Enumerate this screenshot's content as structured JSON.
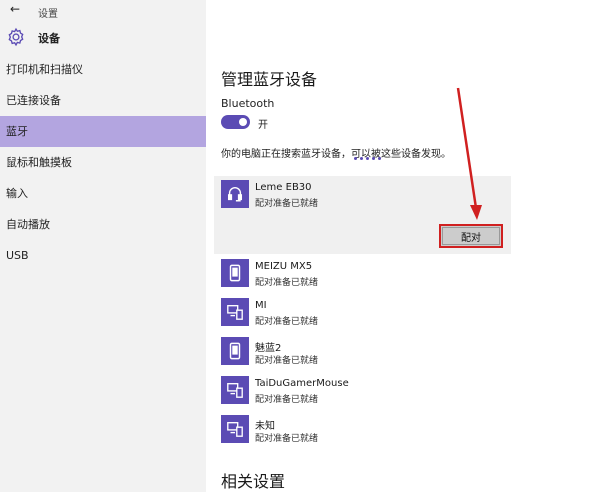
{
  "window": {
    "title": "设置",
    "back_glyph": "←"
  },
  "header": {
    "title": "设备"
  },
  "sidebar": {
    "items": [
      {
        "label": "打印机和扫描仪",
        "active": false
      },
      {
        "label": "已连接设备",
        "active": false
      },
      {
        "label": "蓝牙",
        "active": true
      },
      {
        "label": "鼠标和触摸板",
        "active": false
      },
      {
        "label": "输入",
        "active": false
      },
      {
        "label": "自动播放",
        "active": false
      },
      {
        "label": "USB",
        "active": false
      }
    ]
  },
  "main": {
    "title": "管理蓝牙设备",
    "bluetooth_label": "Bluetooth",
    "toggle_state": "开",
    "search_text": "你的电脑正在搜索蓝牙设备，可以被这些设备发现。",
    "pair_button": "配对",
    "related_title": "相关设置",
    "devices": [
      {
        "name": "Leme EB30",
        "status": "配对准备已就绪",
        "icon": "headset-icon"
      },
      {
        "name": "MEIZU MX5",
        "status": "配对准备已就绪",
        "icon": "phone-icon"
      },
      {
        "name": "MI",
        "status": "配对准备已就绪",
        "icon": "computer-devices-icon"
      },
      {
        "name": "魅蓝2",
        "status": "配对准备已就绪",
        "icon": "phone-icon"
      },
      {
        "name": "TaiDuGamerMouse",
        "status": "配对准备已就绪",
        "icon": "computer-devices-icon"
      },
      {
        "name": "未知",
        "status": "配对准备已就绪",
        "icon": "computer-devices-icon"
      }
    ]
  },
  "colors": {
    "accent": "#5b4bb4",
    "nav_active": "#b3a5e0",
    "annotation": "#d02020"
  }
}
